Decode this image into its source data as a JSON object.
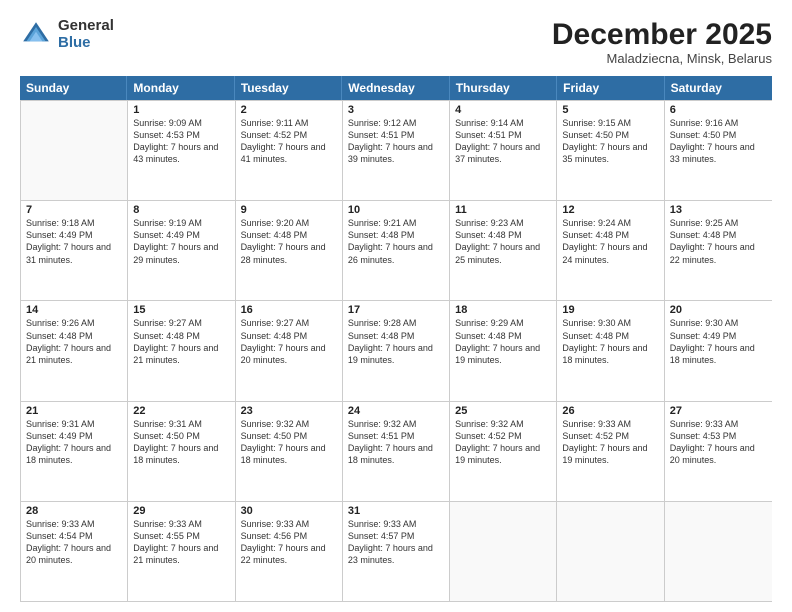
{
  "logo": {
    "general": "General",
    "blue": "Blue"
  },
  "header": {
    "month_year": "December 2025",
    "location": "Maladziecna, Minsk, Belarus"
  },
  "days_of_week": [
    "Sunday",
    "Monday",
    "Tuesday",
    "Wednesday",
    "Thursday",
    "Friday",
    "Saturday"
  ],
  "weeks": [
    [
      {
        "day": "",
        "sunrise": "",
        "sunset": "",
        "daylight": ""
      },
      {
        "day": "1",
        "sunrise": "Sunrise: 9:09 AM",
        "sunset": "Sunset: 4:53 PM",
        "daylight": "Daylight: 7 hours and 43 minutes."
      },
      {
        "day": "2",
        "sunrise": "Sunrise: 9:11 AM",
        "sunset": "Sunset: 4:52 PM",
        "daylight": "Daylight: 7 hours and 41 minutes."
      },
      {
        "day": "3",
        "sunrise": "Sunrise: 9:12 AM",
        "sunset": "Sunset: 4:51 PM",
        "daylight": "Daylight: 7 hours and 39 minutes."
      },
      {
        "day": "4",
        "sunrise": "Sunrise: 9:14 AM",
        "sunset": "Sunset: 4:51 PM",
        "daylight": "Daylight: 7 hours and 37 minutes."
      },
      {
        "day": "5",
        "sunrise": "Sunrise: 9:15 AM",
        "sunset": "Sunset: 4:50 PM",
        "daylight": "Daylight: 7 hours and 35 minutes."
      },
      {
        "day": "6",
        "sunrise": "Sunrise: 9:16 AM",
        "sunset": "Sunset: 4:50 PM",
        "daylight": "Daylight: 7 hours and 33 minutes."
      }
    ],
    [
      {
        "day": "7",
        "sunrise": "Sunrise: 9:18 AM",
        "sunset": "Sunset: 4:49 PM",
        "daylight": "Daylight: 7 hours and 31 minutes."
      },
      {
        "day": "8",
        "sunrise": "Sunrise: 9:19 AM",
        "sunset": "Sunset: 4:49 PM",
        "daylight": "Daylight: 7 hours and 29 minutes."
      },
      {
        "day": "9",
        "sunrise": "Sunrise: 9:20 AM",
        "sunset": "Sunset: 4:48 PM",
        "daylight": "Daylight: 7 hours and 28 minutes."
      },
      {
        "day": "10",
        "sunrise": "Sunrise: 9:21 AM",
        "sunset": "Sunset: 4:48 PM",
        "daylight": "Daylight: 7 hours and 26 minutes."
      },
      {
        "day": "11",
        "sunrise": "Sunrise: 9:23 AM",
        "sunset": "Sunset: 4:48 PM",
        "daylight": "Daylight: 7 hours and 25 minutes."
      },
      {
        "day": "12",
        "sunrise": "Sunrise: 9:24 AM",
        "sunset": "Sunset: 4:48 PM",
        "daylight": "Daylight: 7 hours and 24 minutes."
      },
      {
        "day": "13",
        "sunrise": "Sunrise: 9:25 AM",
        "sunset": "Sunset: 4:48 PM",
        "daylight": "Daylight: 7 hours and 22 minutes."
      }
    ],
    [
      {
        "day": "14",
        "sunrise": "Sunrise: 9:26 AM",
        "sunset": "Sunset: 4:48 PM",
        "daylight": "Daylight: 7 hours and 21 minutes."
      },
      {
        "day": "15",
        "sunrise": "Sunrise: 9:27 AM",
        "sunset": "Sunset: 4:48 PM",
        "daylight": "Daylight: 7 hours and 21 minutes."
      },
      {
        "day": "16",
        "sunrise": "Sunrise: 9:27 AM",
        "sunset": "Sunset: 4:48 PM",
        "daylight": "Daylight: 7 hours and 20 minutes."
      },
      {
        "day": "17",
        "sunrise": "Sunrise: 9:28 AM",
        "sunset": "Sunset: 4:48 PM",
        "daylight": "Daylight: 7 hours and 19 minutes."
      },
      {
        "day": "18",
        "sunrise": "Sunrise: 9:29 AM",
        "sunset": "Sunset: 4:48 PM",
        "daylight": "Daylight: 7 hours and 19 minutes."
      },
      {
        "day": "19",
        "sunrise": "Sunrise: 9:30 AM",
        "sunset": "Sunset: 4:48 PM",
        "daylight": "Daylight: 7 hours and 18 minutes."
      },
      {
        "day": "20",
        "sunrise": "Sunrise: 9:30 AM",
        "sunset": "Sunset: 4:49 PM",
        "daylight": "Daylight: 7 hours and 18 minutes."
      }
    ],
    [
      {
        "day": "21",
        "sunrise": "Sunrise: 9:31 AM",
        "sunset": "Sunset: 4:49 PM",
        "daylight": "Daylight: 7 hours and 18 minutes."
      },
      {
        "day": "22",
        "sunrise": "Sunrise: 9:31 AM",
        "sunset": "Sunset: 4:50 PM",
        "daylight": "Daylight: 7 hours and 18 minutes."
      },
      {
        "day": "23",
        "sunrise": "Sunrise: 9:32 AM",
        "sunset": "Sunset: 4:50 PM",
        "daylight": "Daylight: 7 hours and 18 minutes."
      },
      {
        "day": "24",
        "sunrise": "Sunrise: 9:32 AM",
        "sunset": "Sunset: 4:51 PM",
        "daylight": "Daylight: 7 hours and 18 minutes."
      },
      {
        "day": "25",
        "sunrise": "Sunrise: 9:32 AM",
        "sunset": "Sunset: 4:52 PM",
        "daylight": "Daylight: 7 hours and 19 minutes."
      },
      {
        "day": "26",
        "sunrise": "Sunrise: 9:33 AM",
        "sunset": "Sunset: 4:52 PM",
        "daylight": "Daylight: 7 hours and 19 minutes."
      },
      {
        "day": "27",
        "sunrise": "Sunrise: 9:33 AM",
        "sunset": "Sunset: 4:53 PM",
        "daylight": "Daylight: 7 hours and 20 minutes."
      }
    ],
    [
      {
        "day": "28",
        "sunrise": "Sunrise: 9:33 AM",
        "sunset": "Sunset: 4:54 PM",
        "daylight": "Daylight: 7 hours and 20 minutes."
      },
      {
        "day": "29",
        "sunrise": "Sunrise: 9:33 AM",
        "sunset": "Sunset: 4:55 PM",
        "daylight": "Daylight: 7 hours and 21 minutes."
      },
      {
        "day": "30",
        "sunrise": "Sunrise: 9:33 AM",
        "sunset": "Sunset: 4:56 PM",
        "daylight": "Daylight: 7 hours and 22 minutes."
      },
      {
        "day": "31",
        "sunrise": "Sunrise: 9:33 AM",
        "sunset": "Sunset: 4:57 PM",
        "daylight": "Daylight: 7 hours and 23 minutes."
      },
      {
        "day": "",
        "sunrise": "",
        "sunset": "",
        "daylight": ""
      },
      {
        "day": "",
        "sunrise": "",
        "sunset": "",
        "daylight": ""
      },
      {
        "day": "",
        "sunrise": "",
        "sunset": "",
        "daylight": ""
      }
    ]
  ]
}
